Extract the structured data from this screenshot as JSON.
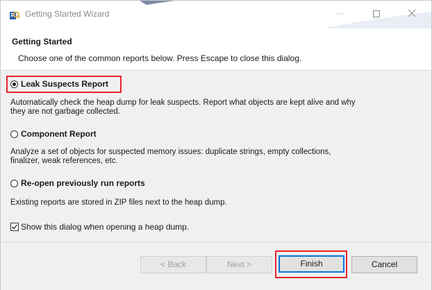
{
  "window": {
    "title": "Getting Started Wizard"
  },
  "header": {
    "title": "Getting Started",
    "description": "Choose one of the common reports below. Press Escape to close this dialog."
  },
  "options": [
    {
      "label": "Leak Suspects Report",
      "selected": true,
      "description": "Automatically check the heap dump for leak suspects. Report what objects are kept alive and why they are not garbage collected."
    },
    {
      "label": "Component Report",
      "selected": false,
      "description": "Analyze a set of objects for suspected memory issues: duplicate strings, empty collections, finalizer, weak references, etc."
    },
    {
      "label": "Re-open previously run reports",
      "selected": false,
      "description": "Existing reports are stored in ZIP files next to the heap dump."
    }
  ],
  "show_dialog_checkbox": {
    "label": "Show this dialog when opening a heap dump.",
    "checked": true
  },
  "buttons": {
    "back": "< Back",
    "next": "Next >",
    "finish": "Finish",
    "cancel": "Cancel"
  },
  "colors": {
    "highlight": "#e8232b",
    "default_button_border": "#0078d7"
  }
}
